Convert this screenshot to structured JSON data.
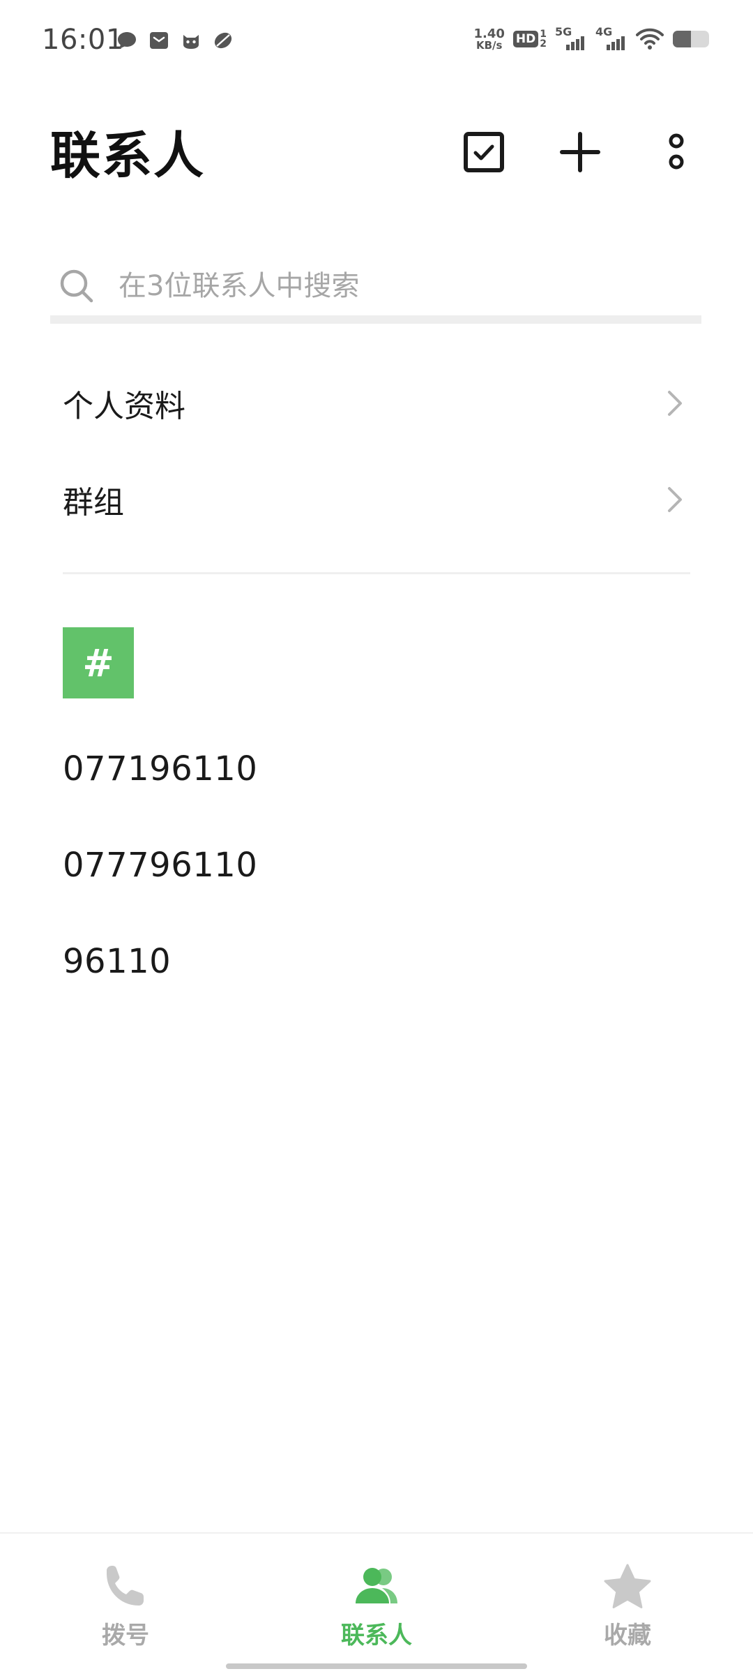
{
  "status_bar": {
    "time": "16:01",
    "net_speed_value": "1.40",
    "net_speed_unit": "KB/s",
    "hd_label": "HD",
    "sim1_label": "5G",
    "sim2_label": "4G",
    "left_icons": [
      "message-icon",
      "mail-icon",
      "cat-face-icon",
      "leaf-icon"
    ],
    "right_icons": [
      "hd-icon",
      "signal-5g-icon",
      "signal-4g-icon",
      "wifi-icon",
      "battery-icon"
    ]
  },
  "header": {
    "title": "联系人",
    "actions": [
      "select-checkbox-icon",
      "add-icon",
      "more-icon"
    ]
  },
  "search": {
    "placeholder": "在3位联系人中搜索",
    "value": ""
  },
  "menu_items": [
    {
      "label": "个人资料"
    },
    {
      "label": "群组"
    }
  ],
  "section": {
    "letter": "#"
  },
  "contacts": [
    {
      "name": "077196110"
    },
    {
      "name": "077796110"
    },
    {
      "name": "96110"
    }
  ],
  "bottom_nav": {
    "tabs": [
      {
        "label": "拨号",
        "icon": "phone-icon",
        "active": false
      },
      {
        "label": "联系人",
        "icon": "contacts-icon",
        "active": true
      },
      {
        "label": "收藏",
        "icon": "star-icon",
        "active": false
      }
    ]
  },
  "colors": {
    "accent": "#4cb85a",
    "section_badge": "#62c26a",
    "inactive": "#a9a9a9"
  }
}
